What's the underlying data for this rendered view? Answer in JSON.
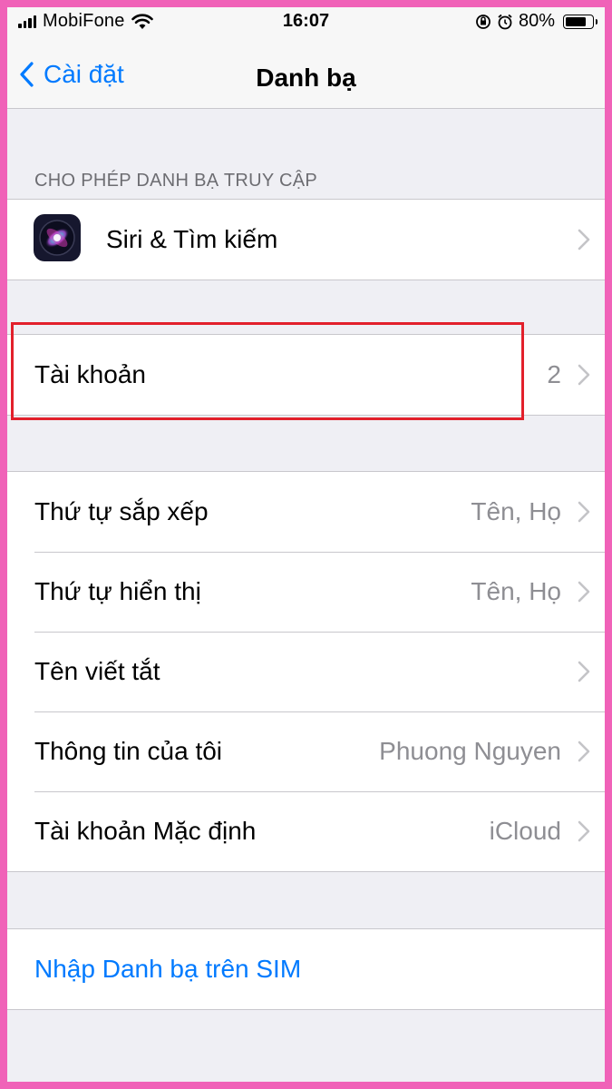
{
  "status_bar": {
    "carrier": "MobiFone",
    "time": "16:07",
    "battery_percent": "80%",
    "battery_level": 0.8,
    "icons": [
      "signal-icon",
      "wifi-icon",
      "orientation-lock-icon",
      "alarm-icon",
      "battery-icon"
    ]
  },
  "nav": {
    "back_label": "Cài đặt",
    "title": "Danh bạ"
  },
  "section_access": {
    "header": "CHO PHÉP DANH BẠ TRUY CẬP",
    "siri_label": "Siri & Tìm kiếm"
  },
  "accounts": {
    "label": "Tài khoản",
    "value": "2"
  },
  "settings": {
    "rows": [
      {
        "label": "Thứ tự sắp xếp",
        "value": "Tên, Họ"
      },
      {
        "label": "Thứ tự hiển thị",
        "value": "Tên, Họ"
      },
      {
        "label": "Tên viết tắt",
        "value": ""
      },
      {
        "label": "Thông tin của tôi",
        "value": "Phuong Nguyen"
      },
      {
        "label": "Tài khoản Mặc định",
        "value": "iCloud"
      }
    ]
  },
  "import": {
    "label": "Nhập Danh bạ trên SIM"
  },
  "colors": {
    "accent": "#007aff",
    "highlight": "#e2202b",
    "frame": "#f062b8",
    "background": "#efeff4"
  }
}
